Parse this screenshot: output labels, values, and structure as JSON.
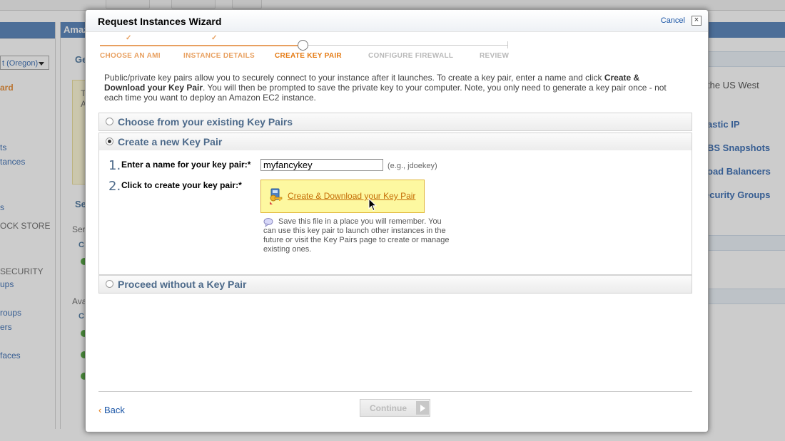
{
  "background": {
    "region_select": "t (Oregon)",
    "nav_items": [
      "ard",
      "ts",
      "tances",
      "s",
      "OCK STORE",
      " SECURITY",
      "ups",
      "roups",
      "ers",
      "faces"
    ],
    "main_title": "Amaz",
    "ghost_texts": [
      "Ge",
      "T",
      "A",
      "Se",
      "Ser",
      "C",
      "Ava",
      "C"
    ],
    "right_text": "the US West",
    "right_links": [
      "astic IP",
      "BS Snapshots",
      "oad Balancers",
      "ecurity Groups"
    ]
  },
  "modal": {
    "title": "Request Instances Wizard",
    "cancel_label": "Cancel",
    "close_glyph": "×",
    "steps": [
      {
        "label": "CHOOSE AN AMI",
        "state": "done"
      },
      {
        "label": "INSTANCE DETAILS",
        "state": "done"
      },
      {
        "label": "CREATE KEY PAIR",
        "state": "current"
      },
      {
        "label": "CONFIGURE FIREWALL",
        "state": "todo"
      },
      {
        "label": "REVIEW",
        "state": "todo"
      }
    ],
    "step_check_glyph": "✓",
    "intro_part1": "Public/private key pairs allow you to securely connect to your instance after it launches. To create a key pair, enter a name and click ",
    "intro_bold": "Create & Download your Key Pair",
    "intro_part2": ". You will then be prompted to save the private key to your computer. Note, you only need to generate a key pair once - not each time you want to deploy an Amazon EC2 instance.",
    "options": {
      "existing": "Choose from your existing Key Pairs",
      "create": "Create a new Key Pair",
      "proceed": "Proceed without a Key Pair"
    },
    "selected_option": "create",
    "step1_num": "1.",
    "step1_label": "Enter a name for your key pair:*",
    "key_name_value": "myfancykey",
    "key_name_example": "(e.g., jdoekey)",
    "step2_num": "2.",
    "step2_label": "Click to create your key pair:*",
    "download_label": "Create & Download your Key Pair",
    "hint_text": "Save this file in a place you will remember. You can use this key pair to launch other instances in the future or visit the Key Pairs page to create or manage existing ones.",
    "back_label": "Back",
    "back_glyph": "‹",
    "continue_label": "Continue"
  },
  "colors": {
    "accent_orange": "#e47911",
    "link_blue": "#1a55a6",
    "section_label": "#4d6a8a",
    "download_bg": "#fdf8a0"
  }
}
